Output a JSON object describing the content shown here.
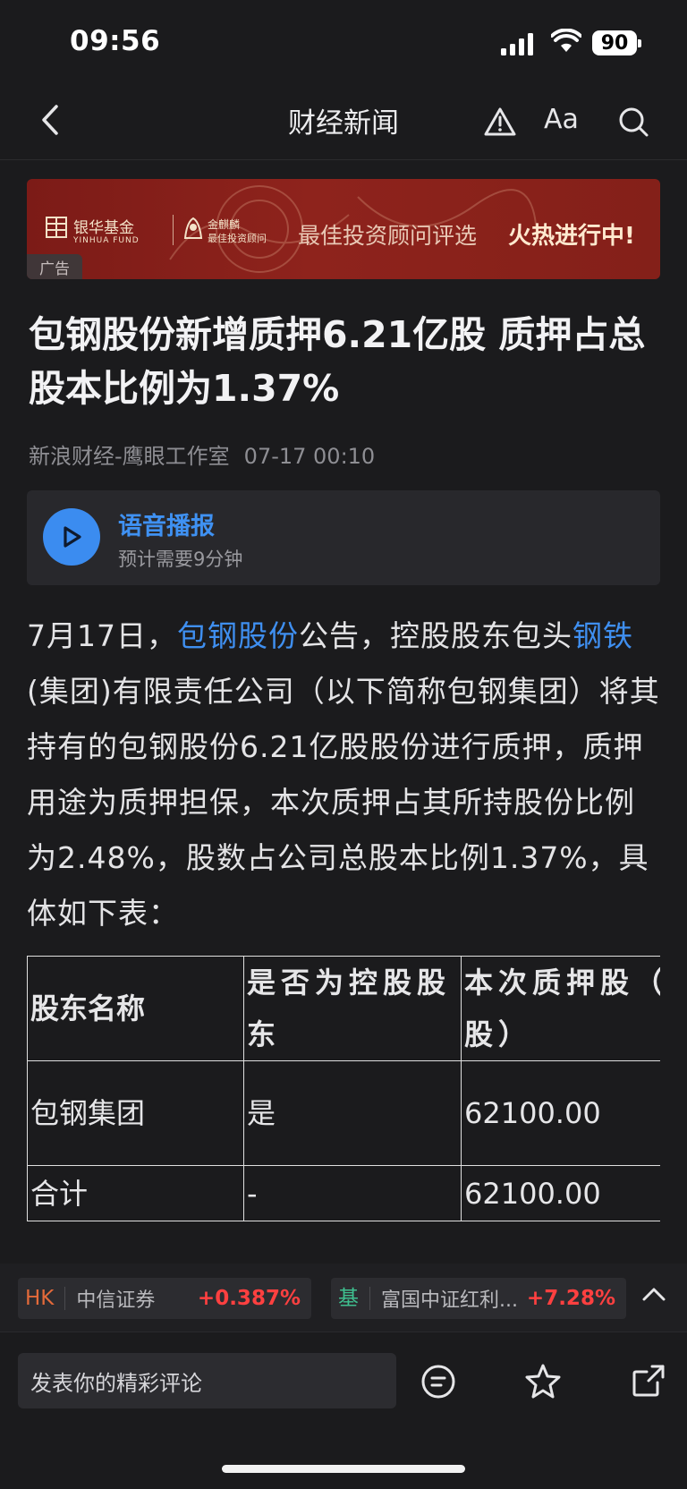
{
  "status_bar": {
    "time": "09:56",
    "battery": "90"
  },
  "nav": {
    "title": "财经新闻",
    "font_button": "Aa"
  },
  "ad": {
    "brand1": "银华基金",
    "brand1_en": "YINHUA FUND",
    "brand2": "金麒麟",
    "brand2_sub": "最佳投资顾问",
    "main_text": "最佳投资顾问评选",
    "hot_text": "火热进行中!",
    "tag": "广告"
  },
  "article": {
    "headline": "包钢股份新增质押6.21亿股 质押占总股本比例为1.37%",
    "source": "新浪财经-鹰眼工作室",
    "time": "07-17 00:10",
    "audio": {
      "title": "语音播报",
      "subtitle": "预计需要9分钟"
    },
    "para": {
      "p1": "7月17日，",
      "link1": "包钢股份",
      "p2": "公告，控股股东包头",
      "link2": "钢铁",
      "p3": "(集团)有限责任公司（以下简称包钢集团）将其持有的包钢股份6.21亿股股份进行质押，质押用途为质押担保，本次质押占其所持股份比例为2.48%，股数占公司总股本比例1.37%，具体如下表："
    },
    "table": {
      "headers": [
        "股东名称",
        "是否为控股股东",
        "本次质押股（万股）"
      ],
      "rows": [
        [
          "包钢集团",
          "是",
          "62100.00"
        ],
        [
          "合计",
          "-",
          "62100.00"
        ]
      ]
    }
  },
  "ticker": [
    {
      "code": "HK",
      "name": "中信证券",
      "change": "+0.387%"
    },
    {
      "code": "基",
      "name": "富国中证红利...",
      "change": "+7.28%"
    }
  ],
  "bottom": {
    "comment_placeholder": "发表你的精彩评论"
  }
}
